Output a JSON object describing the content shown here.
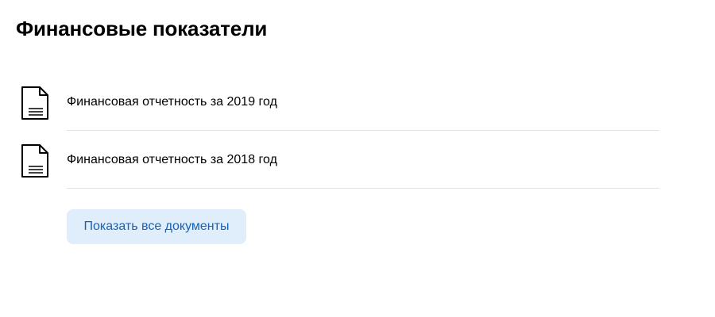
{
  "section": {
    "title": "Финансовые показатели"
  },
  "documents": [
    {
      "title": "Финансовая отчетность за 2019 год",
      "icon": "document-icon"
    },
    {
      "title": "Финансовая отчетность за 2018 год",
      "icon": "document-icon"
    }
  ],
  "actions": {
    "show_all_label": "Показать все документы"
  },
  "colors": {
    "button_background": "#e0edfa",
    "button_text": "#1a62b3",
    "divider": "#e3e3e3"
  }
}
